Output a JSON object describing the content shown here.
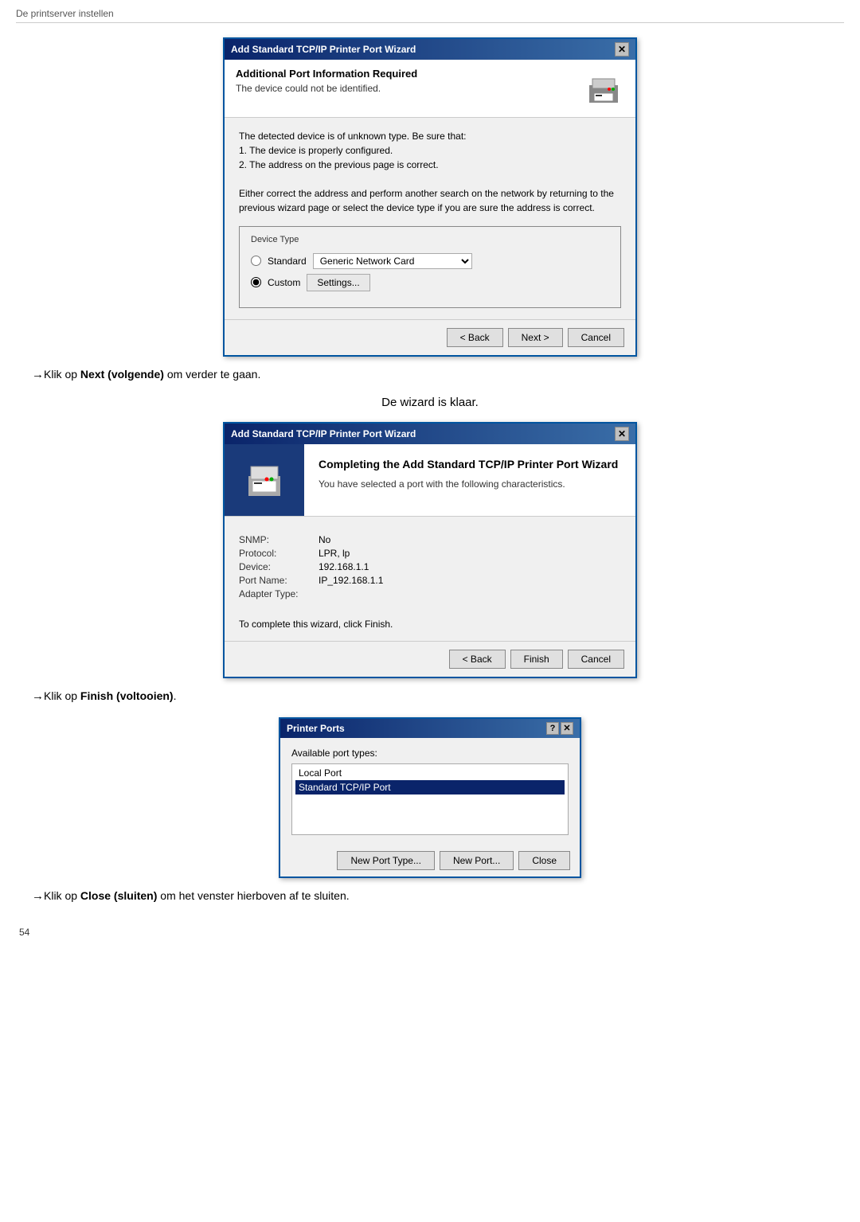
{
  "page": {
    "header": "De printserver instellen",
    "page_number": "54"
  },
  "dialog1": {
    "title": "Add Standard TCP/IP Printer Port Wizard",
    "header_title": "Additional Port Information Required",
    "header_subtitle": "The device could not be identified.",
    "body_text_1": "The detected device is of unknown type.  Be sure that:",
    "body_text_2": "1. The device is properly configured.",
    "body_text_3": "2. The address on the previous page is correct.",
    "body_text_4": "Either correct the address and perform another search on the network by returning to the previous wizard page or select the device type if you are sure the address is correct.",
    "device_type_legend": "Device Type",
    "standard_label": "Standard",
    "standard_dropdown": "Generic Network Card",
    "custom_label": "Custom",
    "settings_btn": "Settings...",
    "back_btn": "< Back",
    "next_btn": "Next >",
    "cancel_btn": "Cancel"
  },
  "instruction1": {
    "arrow": "→",
    "prefix": "Klik op ",
    "bold_text": "Next (volgende)",
    "suffix": " om verder te gaan."
  },
  "section_heading": "De wizard is klaar.",
  "dialog2": {
    "title": "Add Standard TCP/IP Printer Port Wizard",
    "completing_title": "Completing the Add Standard TCP/IP Printer Port Wizard",
    "completing_subtitle": "You have selected a port with the following characteristics.",
    "snmp_label": "SNMP:",
    "snmp_value": "No",
    "protocol_label": "Protocol:",
    "protocol_value": "LPR, lp",
    "device_label": "Device:",
    "device_value": "192.168.1.1",
    "port_name_label": "Port Name:",
    "port_name_value": "IP_192.168.1.1",
    "adapter_type_label": "Adapter Type:",
    "adapter_type_value": "",
    "finish_note": "To complete this wizard, click Finish.",
    "back_btn": "< Back",
    "finish_btn": "Finish",
    "cancel_btn": "Cancel"
  },
  "instruction2": {
    "arrow": "→",
    "prefix": "Klik op ",
    "bold_text": "Finish (voltooien)",
    "suffix": "."
  },
  "dialog3": {
    "title": "Printer Ports",
    "available_label": "Available port types:",
    "port_items": [
      {
        "label": "Local Port",
        "selected": false
      },
      {
        "label": "Standard TCP/IP Port",
        "selected": true
      }
    ],
    "new_port_type_btn": "New Port Type...",
    "new_port_btn": "New Port...",
    "close_btn": "Close"
  },
  "instruction3": {
    "arrow": "→",
    "prefix": "Klik op ",
    "bold_text": "Close (sluiten)",
    "suffix": " om het venster hierboven af te sluiten."
  }
}
